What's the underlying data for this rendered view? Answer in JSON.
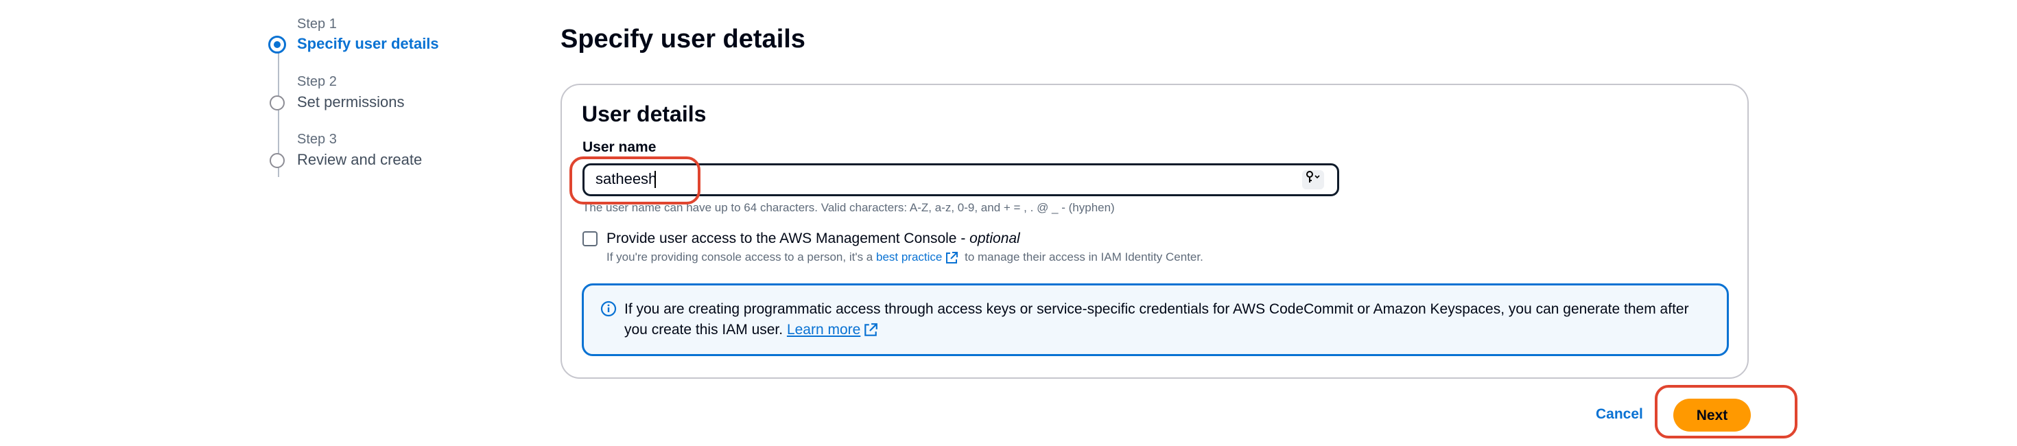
{
  "wizard": {
    "steps": [
      {
        "number_label": "Step 1",
        "title": "Specify user details",
        "active": true
      },
      {
        "number_label": "Step 2",
        "title": "Set permissions",
        "active": false
      },
      {
        "number_label": "Step 3",
        "title": "Review and create",
        "active": false
      }
    ]
  },
  "page": {
    "title": "Specify user details"
  },
  "user_details": {
    "title": "User details",
    "username_label": "User name",
    "username_value": "satheesh",
    "username_constraint": "The user name can have up to 64 characters. Valid characters: A-Z, a-z, 0-9, and + = , . @ _ - (hyphen)",
    "console_access": {
      "label": "Provide user access to the AWS Management Console - ",
      "optional": "optional",
      "checked": false,
      "desc_prefix": "If you're providing console access to a person, it's a ",
      "desc_link": "best practice",
      "desc_suffix": " to manage their access in IAM Identity Center."
    },
    "info": {
      "text": "If you are creating programmatic access through access keys or service-specific credentials for AWS CodeCommit or Amazon Keyspaces, you can generate them after you create this IAM user. ",
      "link": "Learn more"
    }
  },
  "actions": {
    "cancel": "Cancel",
    "next": "Next"
  },
  "colors": {
    "accent": "#0972d3",
    "primary_button": "#ff9900",
    "highlight": "#e0452f"
  },
  "icons": {
    "key": "key-icon",
    "info": "info-icon",
    "external": "external-link-icon"
  }
}
